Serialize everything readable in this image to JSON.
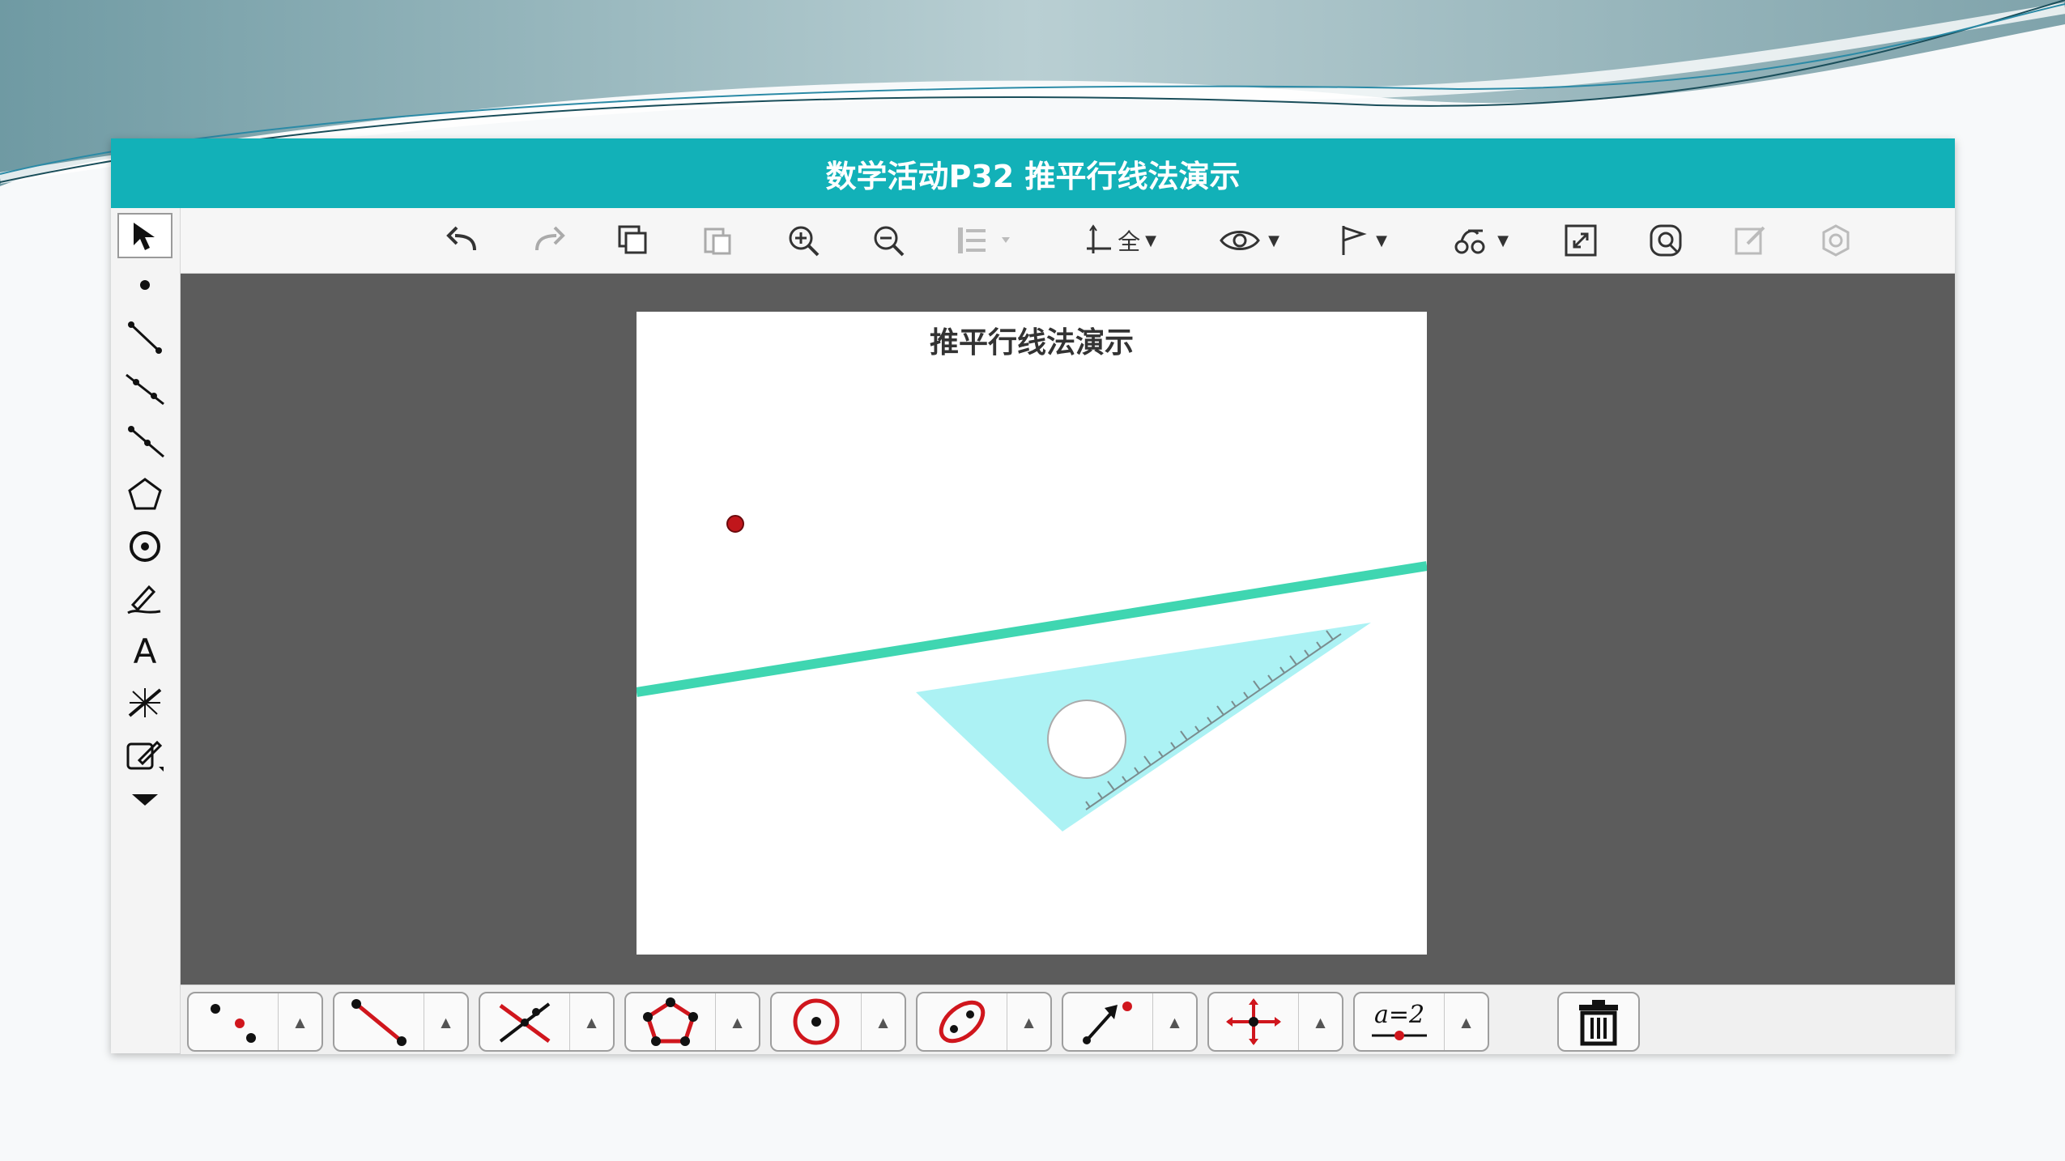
{
  "window": {
    "title": "数学活动P32  推平行线法演示"
  },
  "paper": {
    "title": "推平行线法演示"
  },
  "colors": {
    "titlebar": "#12b1b8",
    "line": "#3fd6b1",
    "triangle_fill": "#a8f1f3",
    "point": "#c0161b",
    "canvas_bg": "#5c5c5c"
  },
  "toolbar": {
    "items": [
      {
        "name": "undo-icon"
      },
      {
        "name": "redo-icon"
      },
      {
        "name": "copy-icon"
      },
      {
        "name": "paste-icon"
      },
      {
        "name": "zoom-in-icon"
      },
      {
        "name": "zoom-out-icon"
      },
      {
        "name": "align-icon"
      },
      {
        "name": "axes-icon",
        "label": "全"
      },
      {
        "name": "eye-icon"
      },
      {
        "name": "flag-icon"
      },
      {
        "name": "transform-icon"
      },
      {
        "name": "fullscreen-icon"
      },
      {
        "name": "search-icon"
      },
      {
        "name": "edit-icon"
      },
      {
        "name": "settings-icon"
      }
    ]
  },
  "sidebar": {
    "items": [
      {
        "name": "select-arrow-icon"
      },
      {
        "name": "point-icon"
      },
      {
        "name": "segment-icon"
      },
      {
        "name": "line-icon"
      },
      {
        "name": "ray-icon"
      },
      {
        "name": "polygon-icon"
      },
      {
        "name": "circle-icon"
      },
      {
        "name": "pen-icon"
      },
      {
        "name": "text-icon",
        "label": "A"
      },
      {
        "name": "laser-icon"
      },
      {
        "name": "edit-note-icon"
      },
      {
        "name": "more-down-icon"
      }
    ]
  },
  "bottom_tools": {
    "items": [
      {
        "name": "points-tool"
      },
      {
        "name": "segment-tool"
      },
      {
        "name": "intersect-tool"
      },
      {
        "name": "polygon-tool"
      },
      {
        "name": "circle-tool"
      },
      {
        "name": "conic-tool"
      },
      {
        "name": "vector-tool"
      },
      {
        "name": "transform-tool"
      },
      {
        "name": "variable-tool",
        "label": "a=2"
      },
      {
        "name": "trash-tool"
      }
    ]
  }
}
